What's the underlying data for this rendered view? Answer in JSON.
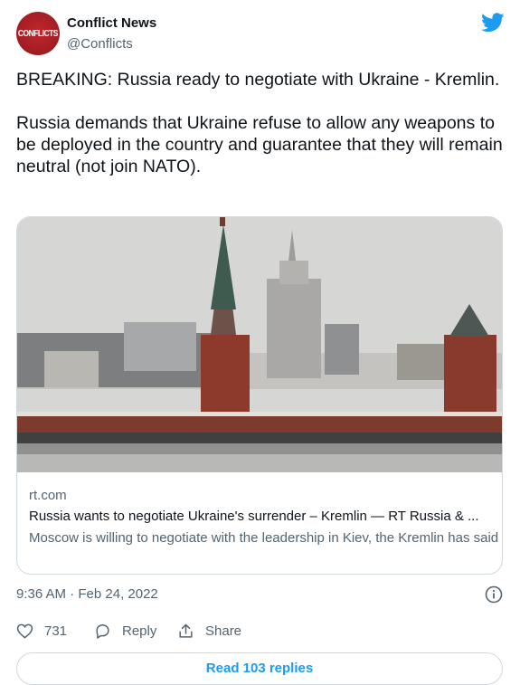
{
  "account": {
    "name": "Conflict News",
    "handle": "@Conflicts",
    "avatar_text": "CONFLICTS"
  },
  "tweet": {
    "paragraph1": "BREAKING: Russia ready to negotiate with Ukraine - Kremlin.",
    "paragraph2": "Russia demands that Ukraine refuse to allow any weapons to be deployed in the country and guarantee that they will remain neutral (not join NATO).",
    "timestamp": "9:36 AM · Feb 24, 2022"
  },
  "card": {
    "domain": "rt.com",
    "title": "Russia wants to negotiate Ukraine's surrender – Kremlin — RT Russia & ...",
    "description": "Moscow is willing to negotiate with the leadership in Kiev, the Kremlin has said"
  },
  "actions": {
    "like_count": "731",
    "reply_label": "Reply",
    "share_label": "Share"
  },
  "footer": {
    "read_replies": "Read 103 replies"
  },
  "colors": {
    "brand_blue": "#1d9bf0",
    "secondary_text": "#536471",
    "border": "#cfd9de"
  }
}
